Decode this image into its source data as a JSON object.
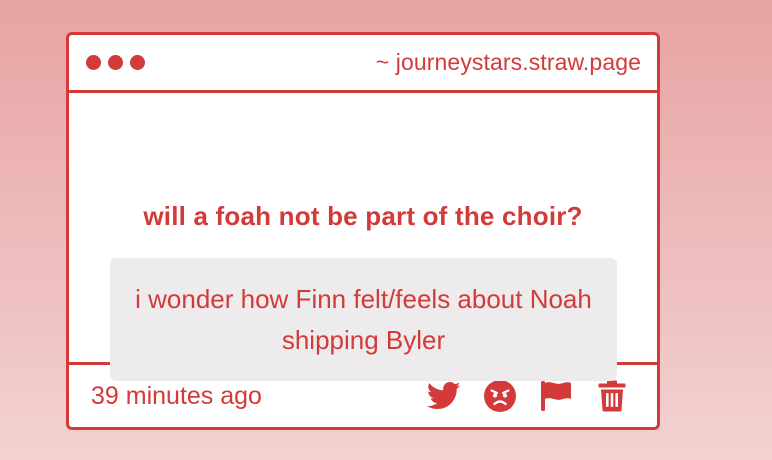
{
  "window": {
    "url": "~ journeystars.straw.page"
  },
  "post": {
    "question": "will a foah not be part of the choir?",
    "answer": "i wonder how Finn felt/feels about Noah shipping Byler",
    "timestamp": "39 minutes ago"
  },
  "actions": [
    {
      "icon": "twitter-icon"
    },
    {
      "icon": "angry-face-icon"
    },
    {
      "icon": "flag-icon"
    },
    {
      "icon": "trash-icon"
    }
  ],
  "colors": {
    "accent": "#d33a3a",
    "card_bg": "#ffffff",
    "answer_bg": "#edebeb",
    "page_bg_top": "#e8a3a3",
    "page_bg_bottom": "#f3d2d2"
  }
}
